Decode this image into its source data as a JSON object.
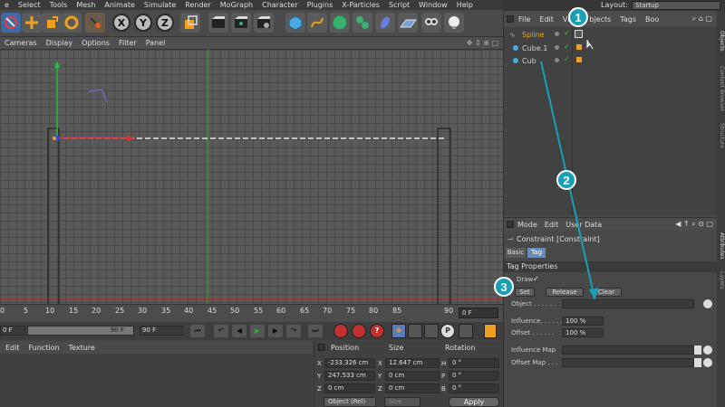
{
  "menu": [
    "e",
    "Select",
    "Tools",
    "Mesh",
    "Animate",
    "Simulate",
    "Render",
    "MoGraph",
    "Character",
    "Plugins",
    "X-Particles",
    "Script",
    "Window",
    "Help"
  ],
  "layout": {
    "label": "Layout:",
    "value": "Startup"
  },
  "toolbar": {
    "x": "X",
    "y": "Y",
    "z": "Z"
  },
  "viewport_menu": [
    "Cameras",
    "Display",
    "Options",
    "Filter",
    "Panel"
  ],
  "timeline": {
    "ticks": [
      "0",
      "5",
      "10",
      "15",
      "20",
      "25",
      "30",
      "35",
      "40",
      "45",
      "50",
      "55",
      "60",
      "65",
      "70",
      "75",
      "80",
      "85",
      "90"
    ],
    "current_frame": "0 F",
    "range_start": "0 F",
    "range_mid": "90 F",
    "range_end": "90 F"
  },
  "material_menu": [
    "Edit",
    "Function",
    "Texture"
  ],
  "coords": {
    "position_label": "Position",
    "size_label": "Size",
    "rotation_label": "Rotation",
    "rows": [
      {
        "axis": "X",
        "pos": "-233.326 cm",
        "size_axis": "X",
        "size": "12.647 cm",
        "rot_axis": "H",
        "rot": "0 °"
      },
      {
        "axis": "Y",
        "pos": "247.533 cm",
        "size_axis": "Y",
        "size": "0 cm",
        "rot_axis": "P",
        "rot": "0 °"
      },
      {
        "axis": "Z",
        "pos": "0 cm",
        "size_axis": "Z",
        "size": "0 cm",
        "rot_axis": "B",
        "rot": "0 °"
      }
    ],
    "mode": "Object (Rel)",
    "size_mode": "Size",
    "apply": "Apply"
  },
  "object_manager": {
    "menu": [
      "File",
      "Edit",
      "Vie",
      "bjects",
      "Tags",
      "Boo"
    ],
    "objects": [
      {
        "name": "Spline",
        "color": "#f0a020"
      },
      {
        "name": "Cube.1",
        "color": "#cfcfcf"
      },
      {
        "name": "Cub",
        "color": "#cfcfcf"
      }
    ]
  },
  "attribute_manager": {
    "menu": [
      "Mode",
      "Edit",
      "User Data"
    ],
    "title": "Constraint [Constraint]",
    "tabs": [
      "Basic",
      "Tag"
    ],
    "section": "Tag Properties",
    "draw_label": "Draw",
    "draw_check": "✓",
    "buttons": [
      "Set",
      "Release",
      "Clear"
    ],
    "object_label": "Object . . . . . .",
    "influence_label": "Influence. . . . . .",
    "influence_value": "100 %",
    "offset_label": "Offset . . . . . .",
    "offset_value": "100 %",
    "influence_map_label": "Influence Map",
    "offset_map_label": "Offset Map . . ."
  },
  "side_tabs": [
    "Objects",
    "Content Browser",
    "Structure",
    "Attributes",
    "Layers"
  ],
  "badges": [
    "1",
    "2",
    "3"
  ],
  "colors": {
    "accent": "#1aa0b5",
    "spline": "#f0a020",
    "y_axis": "#22c040",
    "x_axis": "#e03030"
  }
}
